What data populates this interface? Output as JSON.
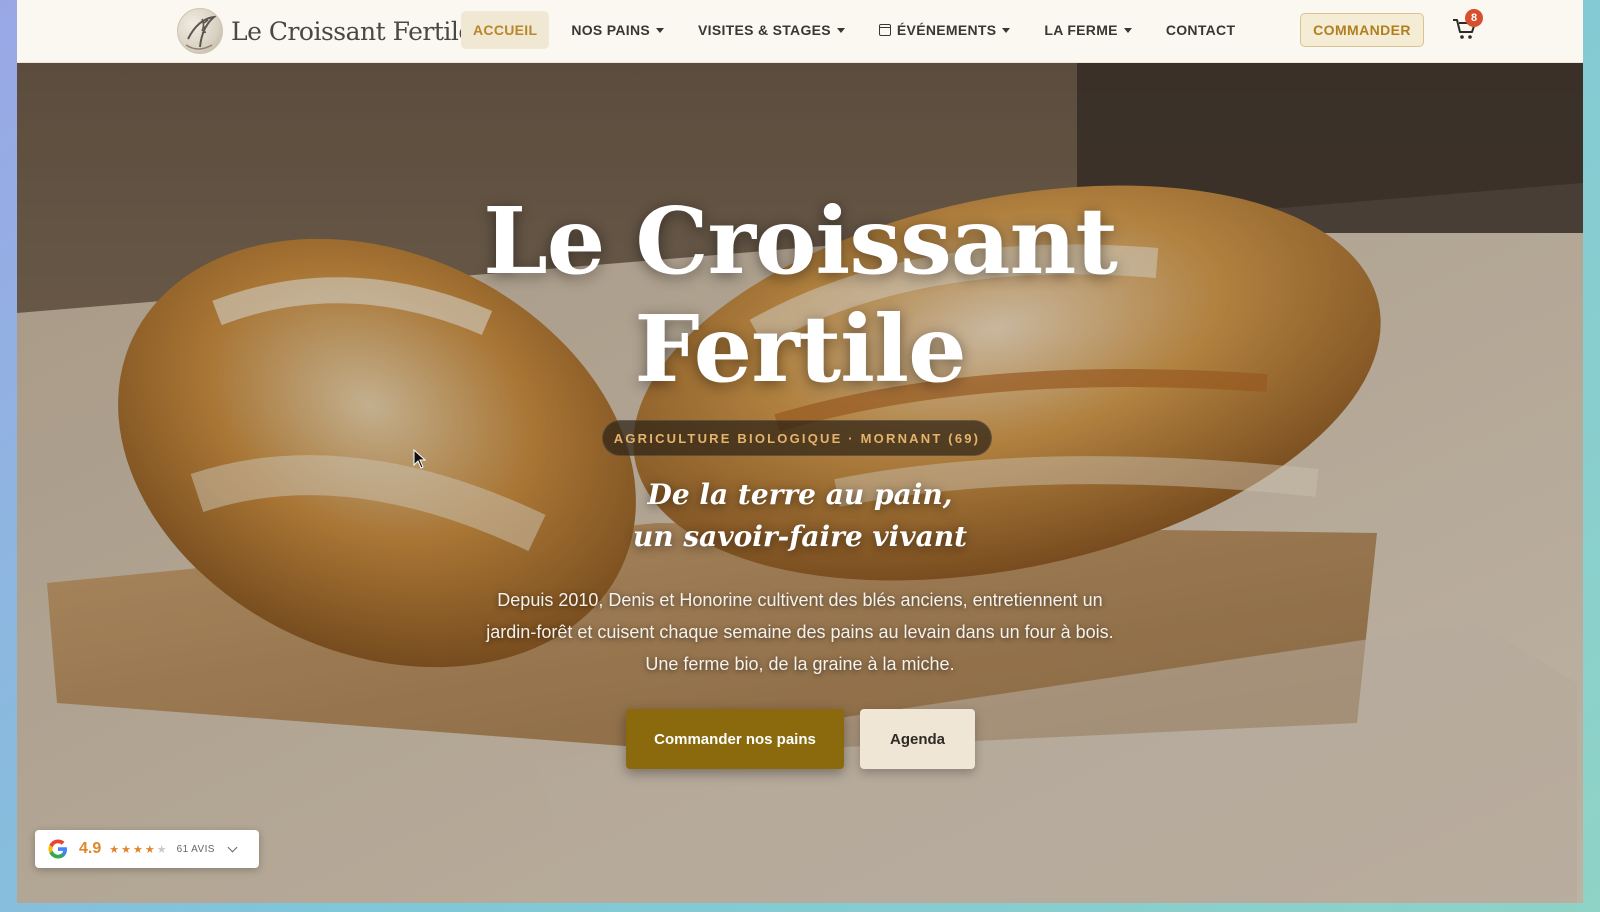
{
  "brand": {
    "name": "Le Croissant Fertile"
  },
  "nav": {
    "items": [
      {
        "label": "ACCUEIL",
        "active": true,
        "dropdown": false
      },
      {
        "label": "NOS PAINS",
        "active": false,
        "dropdown": true
      },
      {
        "label": "VISITES & STAGES",
        "active": false,
        "dropdown": true
      },
      {
        "label": "ÉVÉNEMENTS",
        "active": false,
        "dropdown": true,
        "icon": "calendar-icon"
      },
      {
        "label": "LA FERME",
        "active": false,
        "dropdown": true
      },
      {
        "label": "CONTACT",
        "active": false,
        "dropdown": false
      }
    ],
    "order_label": "COMMANDER",
    "cart_count": "8"
  },
  "hero": {
    "title_line1": "Le Croissant",
    "title_line2": "Fertile",
    "pill": "AGRICULTURE BIOLOGIQUE · MORNANT (69)",
    "tagline_line1": "De la terre au pain,",
    "tagline_line2": "un savoir-faire vivant",
    "desc_line1": "Depuis 2010, Denis et Honorine cultivent des blés anciens, entretiennent un",
    "desc_line2": "jardin-forêt et cuisent chaque semaine des pains au levain dans un four à bois.",
    "desc_line3": "Une ferme bio, de la graine à la miche.",
    "cta_primary": "Commander nos pains",
    "cta_secondary": "Agenda"
  },
  "review_widget": {
    "rating": "4.9",
    "stars_filled": 4,
    "stars_total": 5,
    "count": "61 AVIS"
  },
  "colors": {
    "accent": "#b8862b",
    "primary_button": "#8a6a0c",
    "badge": "#d7502e"
  }
}
